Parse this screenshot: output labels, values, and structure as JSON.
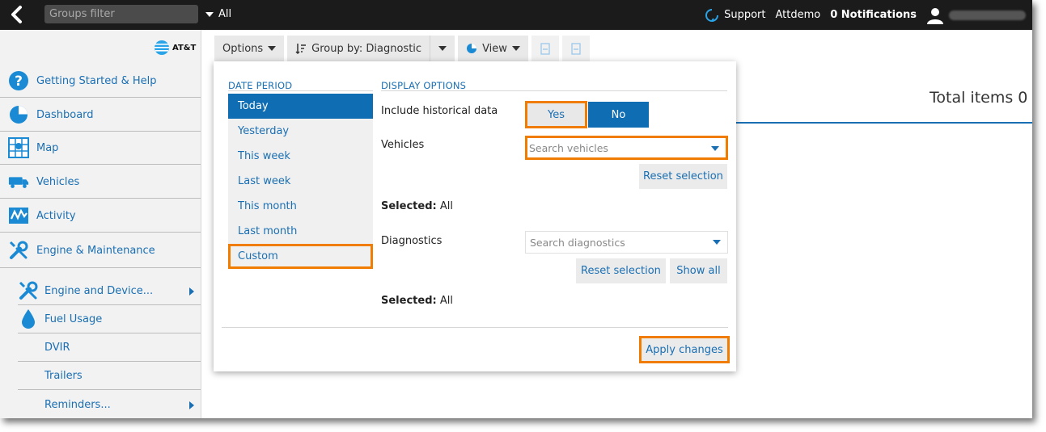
{
  "topbar": {
    "groups_filter_placeholder": "Groups filter",
    "groups_value": "All",
    "support_label": "Support",
    "user_name": "Attdemo",
    "notifications_label": "0 Notifications"
  },
  "brand": {
    "name": "AT&T"
  },
  "sidebar": {
    "items": [
      {
        "label": "Getting Started & Help",
        "icon": "help-icon"
      },
      {
        "label": "Dashboard",
        "icon": "pie-chart-icon"
      },
      {
        "label": "Map",
        "icon": "map-icon"
      },
      {
        "label": "Vehicles",
        "icon": "truck-icon"
      },
      {
        "label": "Activity",
        "icon": "activity-icon"
      },
      {
        "label": "Engine & Maintenance",
        "icon": "wrench-icon"
      }
    ],
    "subitems": [
      {
        "label": "Engine and Device...",
        "icon": "wrench-icon"
      },
      {
        "label": "Fuel Usage",
        "icon": "fuel-drop-icon"
      },
      {
        "label": "DVIR"
      },
      {
        "label": "Trailers"
      },
      {
        "label": "Reminders..."
      }
    ]
  },
  "toolbar": {
    "options_label": "Options",
    "group_by_label": "Group by: Diagnostic",
    "view_label": "View"
  },
  "main": {
    "total_items": "Total items 0"
  },
  "popup": {
    "date_period_title": "DATE PERIOD",
    "display_options_title": "DISPLAY OPTIONS",
    "date_periods": [
      "Today",
      "Yesterday",
      "This week",
      "Last week",
      "This month",
      "Last month",
      "Custom"
    ],
    "selected_period": "Today",
    "include_historical_label": "Include historical data",
    "yes_label": "Yes",
    "no_label": "No",
    "vehicles_label": "Vehicles",
    "vehicles_placeholder": "Search vehicles",
    "reset_selection_label": "Reset selection",
    "selected_prefix": "Selected:",
    "selected_vehicles": "All",
    "diagnostics_label": "Diagnostics",
    "diagnostics_placeholder": "Search diagnostics",
    "show_all_label": "Show all",
    "selected_diagnostics": "All",
    "apply_label": "Apply changes"
  },
  "colors": {
    "accent": "#0f6db3",
    "highlight": "#f07d00",
    "topbar": "#1b1b1b"
  }
}
